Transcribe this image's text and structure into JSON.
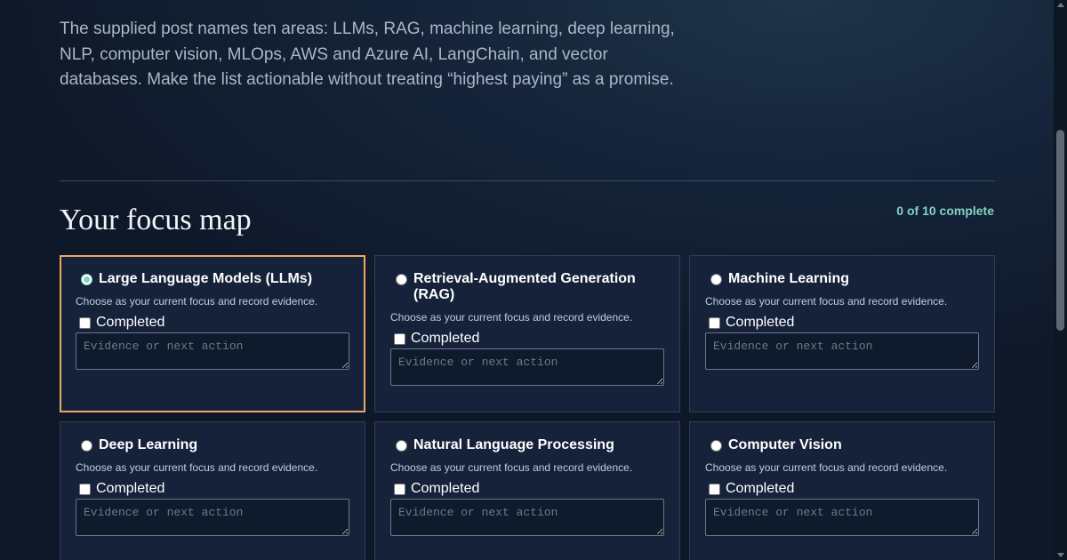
{
  "intro": {
    "text": "The supplied post names ten areas: LLMs, RAG, machine learning, deep learning, NLP, computer vision, MLOps, AWS and Azure AI, LangChain, and vector databases. Make the list actionable without treating “highest paying” as a promise."
  },
  "focus_map": {
    "title": "Your focus map",
    "progress": "0 of 10 complete",
    "accent_color": "#f0a56a",
    "progress_color": "#7fd4c4",
    "cards": [
      {
        "title": "Large Language Models (LLMs)",
        "subtitle": "Choose as your current focus and record evidence.",
        "completed_label": "Completed",
        "evidence_placeholder": "Evidence or next action",
        "selected": true
      },
      {
        "title": "Retrieval-Augmented Generation (RAG)",
        "subtitle": "Choose as your current focus and record evidence.",
        "completed_label": "Completed",
        "evidence_placeholder": "Evidence or next action",
        "selected": false
      },
      {
        "title": "Machine Learning",
        "subtitle": "Choose as your current focus and record evidence.",
        "completed_label": "Completed",
        "evidence_placeholder": "Evidence or next action",
        "selected": false
      },
      {
        "title": "Deep Learning",
        "subtitle": "Choose as your current focus and record evidence.",
        "completed_label": "Completed",
        "evidence_placeholder": "Evidence or next action",
        "selected": false
      },
      {
        "title": "Natural Language Processing",
        "subtitle": "Choose as your current focus and record evidence.",
        "completed_label": "Completed",
        "evidence_placeholder": "Evidence or next action",
        "selected": false
      },
      {
        "title": "Computer Vision",
        "subtitle": "Choose as your current focus and record evidence.",
        "completed_label": "Completed",
        "evidence_placeholder": "Evidence or next action",
        "selected": false
      }
    ]
  }
}
